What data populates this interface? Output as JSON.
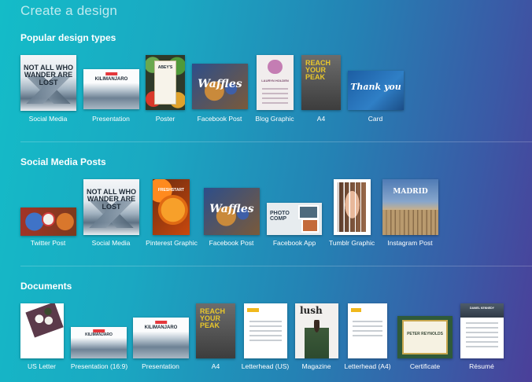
{
  "page": {
    "title": "Create a design"
  },
  "sections": [
    {
      "heading": "Popular design types",
      "tiles": [
        {
          "label": "Social Media",
          "art_text": "NOT ALL WHO WANDER ARE LOST"
        },
        {
          "label": "Presentation",
          "art_text": "KILIMANJARO"
        },
        {
          "label": "Poster",
          "art_text": "ABEY'S"
        },
        {
          "label": "Facebook Post",
          "art_text": "Waffles"
        },
        {
          "label": "Blog Graphic",
          "art_text": "LAURYN HOLDEN"
        },
        {
          "label": "A4",
          "art_text": "REACH YOUR PEAK"
        },
        {
          "label": "Card",
          "art_text": "Thank you"
        }
      ]
    },
    {
      "heading": "Social Media Posts",
      "tiles": [
        {
          "label": "Twitter Post",
          "art_text": ""
        },
        {
          "label": "Social Media",
          "art_text": "NOT ALL WHO WANDER ARE LOST"
        },
        {
          "label": "Pinterest Graphic",
          "art_text": "FRESHSTART"
        },
        {
          "label": "Facebook Post",
          "art_text": "Waffles"
        },
        {
          "label": "Facebook App",
          "art_text": "PHOTO COMP"
        },
        {
          "label": "Tumblr Graphic",
          "art_text": ""
        },
        {
          "label": "Instagram Post",
          "art_text": "MADRID"
        }
      ]
    },
    {
      "heading": "Documents",
      "tiles": [
        {
          "label": "US Letter",
          "art_text": ""
        },
        {
          "label": "Presentation (16:9)",
          "art_text": "KILIMANJARO"
        },
        {
          "label": "Presentation",
          "art_text": "KILIMANJARO"
        },
        {
          "label": "A4",
          "art_text": "REACH YOUR PEAK"
        },
        {
          "label": "Letterhead (US)",
          "art_text": ""
        },
        {
          "label": "Magazine",
          "art_text": "lush"
        },
        {
          "label": "Letterhead (A4)",
          "art_text": ""
        },
        {
          "label": "Certificate",
          "art_text": "PETER REYNOLDS"
        },
        {
          "label": "Résumé",
          "art_text": "DANIEL KENNEDY"
        }
      ]
    }
  ]
}
